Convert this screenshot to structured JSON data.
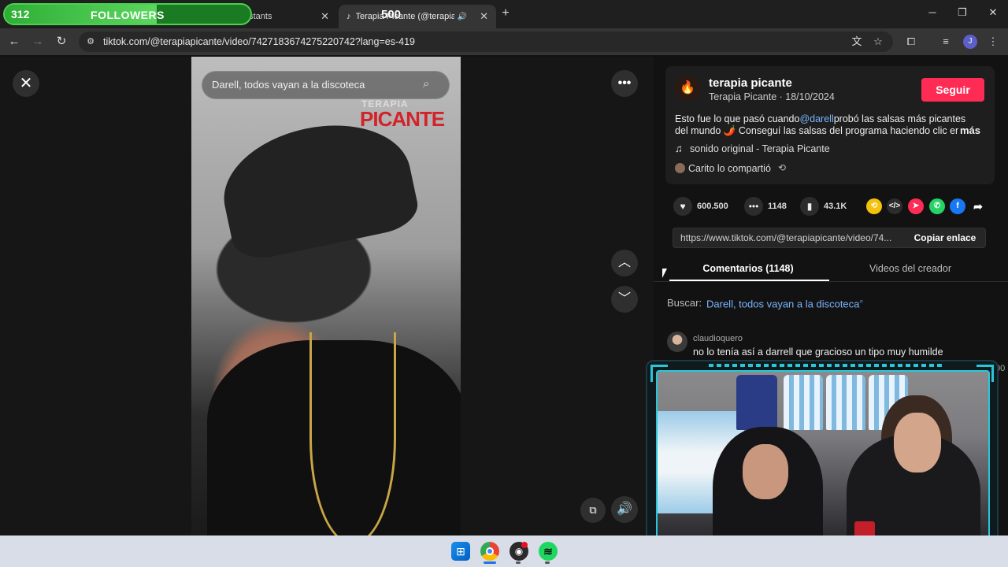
{
  "overlay": {
    "followers_count": "312",
    "followers_label": "FOLLOWERS",
    "followers_goal": "500",
    "followers_progress": 0.62
  },
  "browser": {
    "tabs": [
      {
        "title": "nstants",
        "close": "✕"
      },
      {
        "title": "Terapia Picante (@terapiapi",
        "close": "✕",
        "audio_icon": "speaker-icon"
      }
    ],
    "new_tab": "+",
    "window_controls": [
      "─",
      "❐",
      "✕"
    ],
    "url": "tiktok.com/@terapiapicante/video/7427183674275220742?lang=es-419",
    "profile_initial": "J",
    "nav": {
      "back": "←",
      "forward": "→",
      "reload": "↻"
    }
  },
  "video": {
    "search_text": "Darell, todos vayan a la discoteca",
    "logo_line1": "TERAPIA",
    "logo_line2": "PICANTE",
    "close_icon": "✕",
    "more_icon": "•••",
    "up_icon": "︿",
    "down_icon": "﹀",
    "volume_icon": "🔊",
    "pip_icon": "⧉"
  },
  "post": {
    "author_name": "terapia picante",
    "author_sub": "Terapia Picante · 18/10/2024",
    "follow_label": "Seguir",
    "desc_prefix": "Esto fue lo que pasó cuando",
    "desc_mention": "@darell",
    "desc_suffix": "probó las salsas más picantes",
    "desc_line2": "del mundo 🌶️ Conseguí las salsas del programa haciendo clic en...",
    "more_label": "más",
    "sound": "sonido original - Terapia Picante",
    "shared_by": "Carito lo compartió",
    "likes": "600.500",
    "comments": "1148",
    "saves": "43.1K",
    "link": "https://www.tiktok.com/@terapiapicante/video/74...",
    "copy_label": "Copiar enlace",
    "tab_comments": "Comentarios (1148)",
    "tab_creator": "Videos del creador",
    "search_label": "Buscar:",
    "search_query": "Darell, todos vayan a la discoteca",
    "comment": {
      "user": "claudioquero",
      "text": "no lo tenía así a darrell que gracioso un tipo muy humilde",
      "trailing": "00"
    }
  },
  "colors": {
    "accent": "#fe2c55",
    "link": "#7ab4ff",
    "followers_bar": "#2fae36",
    "cam_frame": "#27c7d8"
  },
  "taskbar": [
    "windows-icon",
    "chrome-icon",
    "obs-icon",
    "spotify-icon"
  ]
}
